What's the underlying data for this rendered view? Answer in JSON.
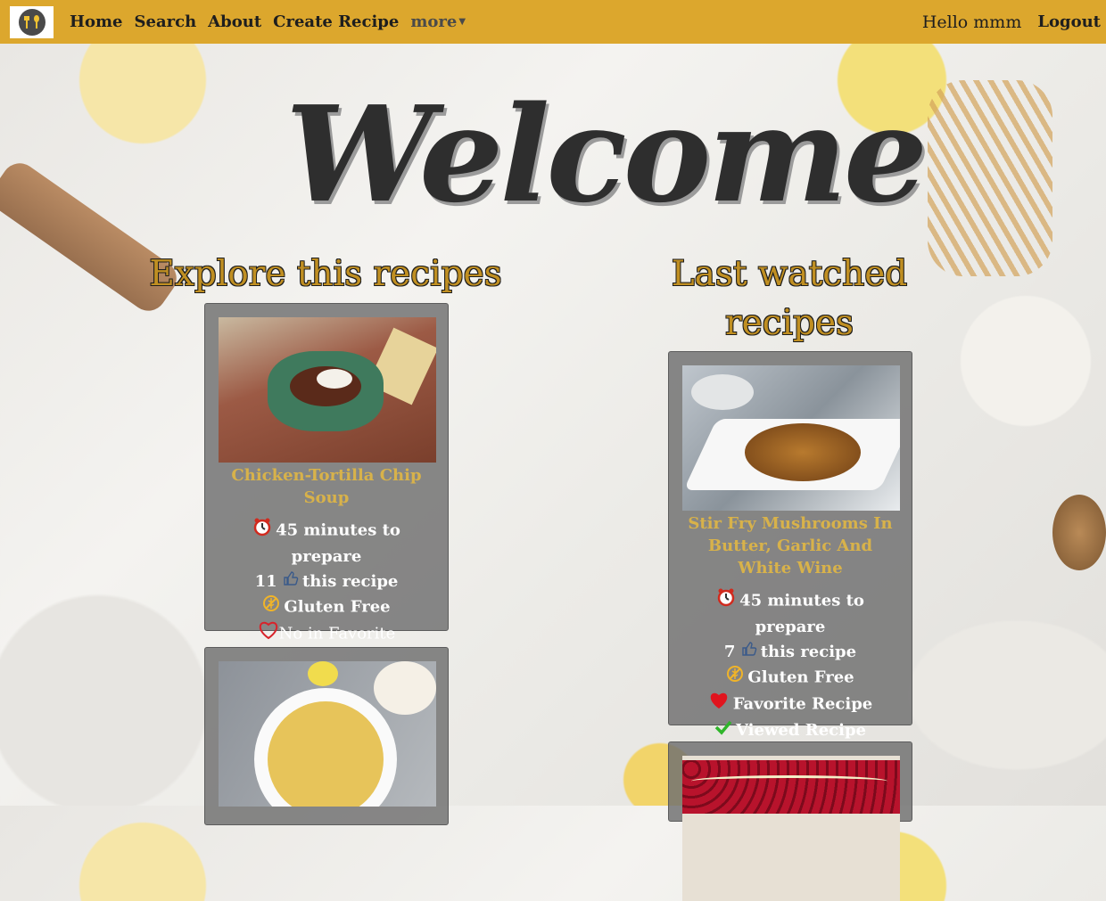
{
  "navbar": {
    "links": [
      "Home",
      "Search",
      "About",
      "Create Recipe"
    ],
    "more_label": "more",
    "greeting": "Hello mmm",
    "logout_label": "Logout"
  },
  "welcome_text": "Welcome",
  "explore": {
    "title": "Explore this recipes",
    "cards": [
      {
        "name": "Chicken-Tortilla Chip Soup",
        "prep": "45 minutes to prepare",
        "likes": "11",
        "likes_suffix": "this recipe",
        "diet": "Gluten Free",
        "favorite": "No in Favorite"
      }
    ]
  },
  "last_watched": {
    "title": "Last watched recipes",
    "cards": [
      {
        "name": "Stir Fry Mushrooms In Butter, Garlic And White Wine",
        "prep": "45 minutes to prepare",
        "likes": "7",
        "likes_suffix": "this recipe",
        "diet": "Gluten Free",
        "favorite": "Favorite Recipe",
        "viewed": "Viewed Recipe"
      }
    ]
  },
  "colors": {
    "navbar": "#dca72d",
    "heading": "#c08f22",
    "recipe_name": "#d8b24a",
    "card_bg": "#707070"
  }
}
